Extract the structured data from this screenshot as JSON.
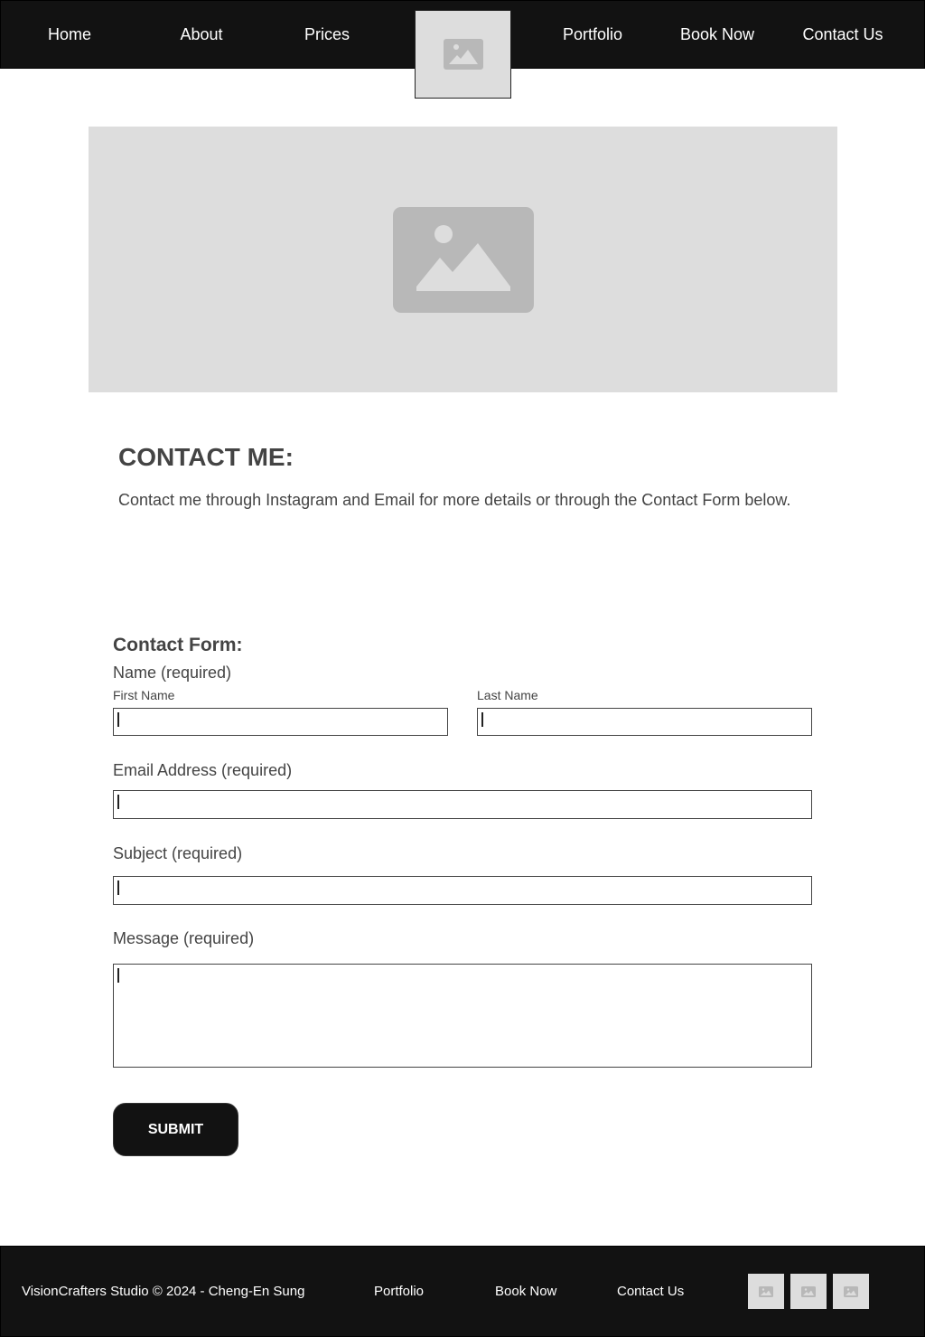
{
  "nav": {
    "items": [
      {
        "label": "Home"
      },
      {
        "label": "About"
      },
      {
        "label": "Prices"
      },
      {
        "label": "Portfolio"
      },
      {
        "label": "Book Now"
      },
      {
        "label": "Contact Us"
      }
    ],
    "logo_icon": "image-placeholder-icon"
  },
  "hero": {
    "icon": "image-placeholder-icon"
  },
  "contact": {
    "title": "CONTACT ME:",
    "description": "Contact me through Instagram and Email for more details or through the Contact Form below."
  },
  "form": {
    "title": "Contact Form:",
    "name_label": "Name (required)",
    "first_name_label": "First Name",
    "first_name_value": "",
    "last_name_label": "Last Name",
    "last_name_value": "",
    "email_label": "Email Address (required)",
    "email_value": "",
    "subject_label": "Subject (required)",
    "subject_value": "",
    "message_label": "Message (required)",
    "message_value": "",
    "submit_label": "SUBMIT"
  },
  "footer": {
    "copyright": "VisionCrafters Studio © 2024 - Cheng-En Sung",
    "links": [
      {
        "label": "Portfolio"
      },
      {
        "label": "Book Now"
      },
      {
        "label": "Contact Us"
      }
    ],
    "social_icons": [
      "image-placeholder-icon",
      "image-placeholder-icon",
      "image-placeholder-icon"
    ]
  },
  "colors": {
    "header_bg": "#121212",
    "placeholder_bg": "#dddddd",
    "placeholder_icon": "#b8b8b8",
    "text": "#444444",
    "button_bg": "#121212"
  }
}
